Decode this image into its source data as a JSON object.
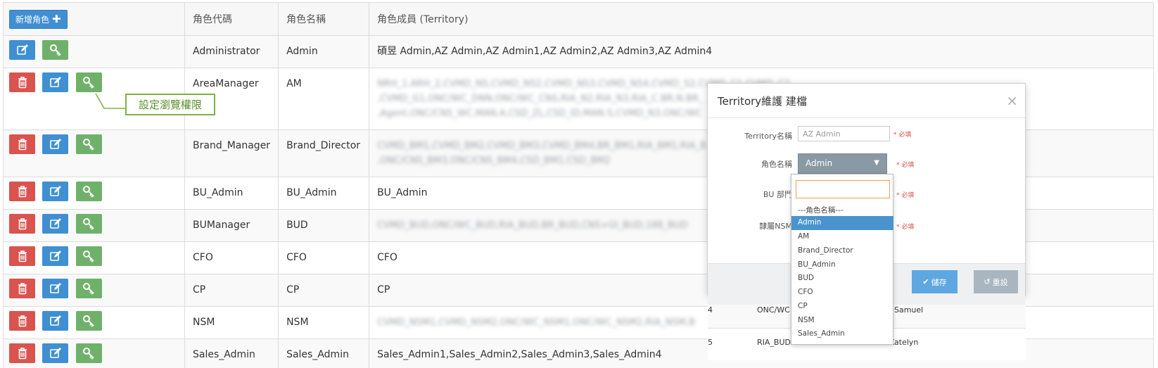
{
  "toolbar": {
    "add_role_label": "新增角色"
  },
  "table": {
    "headers": {
      "code": "角色代碼",
      "name": "角色名稱",
      "members": "角色成員 (Territory)"
    },
    "rows": [
      {
        "code": "Administrator",
        "name": "Admin",
        "members": "碩昱 Admin,AZ Admin,AZ Admin1,AZ Admin2,AZ Admin3,AZ Admin4",
        "delete": false
      },
      {
        "code": "AreaManager",
        "name": "AM",
        "members_line1": "NRH_1.ARH_2,CVMD_NS,CVMD_NS2,CVMD_NS3,CVMD_NS4,CVMD_S2,CVMD_C1,CVMD_C2,",
        "members_line2": ",CVMD_G1,ONC/WC_DNN,ONC/WC_CNS,RIA_N2,RIA_N3,RIA_C.BR,N.BR_",
        "members_line3": ",Agent,ONC/CNS_WC,MAN.A,CSD_ZL,CSD_ID,MAN.S,CVMD_N3,ONC/WC",
        "delete": true
      },
      {
        "code": "Brand_Manager",
        "name": "Brand_Director",
        "members_line1": "CVMD_BM1,CVMD_BM2,CVMD_BM3,CVMD_BM4,BR_BM1,RIA_BM1,RIA_B",
        "members_line2": ",ONC/CNS_BM3,ONC/CNS_BM4,CSD_BM1,CSD_BM2",
        "delete": true
      },
      {
        "code": "BU_Admin",
        "name": "BU_Admin",
        "members": "BU_Admin",
        "delete": true
      },
      {
        "code": "BUManager",
        "name": "BUD",
        "members_blur": "CVMD_BUD,ONC/WC_BUD,RIA_BUD,BR_BUD,CNS+GI_BUD,188_BUD",
        "delete": true
      },
      {
        "code": "CFO",
        "name": "CFO",
        "members": "CFO",
        "delete": true
      },
      {
        "code": "CP",
        "name": "CP",
        "members": "CP",
        "delete": true
      },
      {
        "code": "NSM",
        "name": "NSM",
        "members_blur": "CVMD_NSM1,CVMD_NSM2,ONC/WC_NSM1,ONC/WC_NSM2,RIA_NSM,B",
        "delete": true
      },
      {
        "code": "Sales_Admin",
        "name": "Sales_Admin",
        "members": "Sales_Admin1,Sales_Admin2,Sales_Admin3,Sales_Admin4",
        "delete": true
      }
    ]
  },
  "callout": {
    "text": "設定瀏覽權限"
  },
  "modal": {
    "title": "Territory維護 建檔",
    "territory_label": "Territory名稱",
    "territory_value": "AZ Admin",
    "role_label": "角色名稱",
    "role_value": "Admin",
    "bu_label": "BU 部門",
    "nsm_label": "隸屬NSM",
    "required": "* 必填",
    "save_label": "儲存",
    "reset_label": "重設",
    "under_rows": [
      {
        "c1": "4",
        "c2": "ONC/WC",
        "c3": ", Samuel"
      },
      {
        "c1": "5",
        "c2": "RIA_BUD",
        "c3": "Katelyn"
      }
    ]
  },
  "dropdown": {
    "options": [
      "---角色名稱---",
      "Admin",
      "AM",
      "Brand_Director",
      "BU_Admin",
      "BUD",
      "CFO",
      "CP",
      "NSM",
      "Sales_Admin"
    ],
    "selected": "Admin"
  },
  "colors": {
    "primary": "#3f8fd2",
    "danger": "#d9534f",
    "success": "#6fb16a",
    "callout": "#7cb342"
  },
  "icons": {
    "delete": "trash-icon",
    "edit": "edit-icon",
    "permission": "key-icon",
    "add": "plus-icon"
  }
}
